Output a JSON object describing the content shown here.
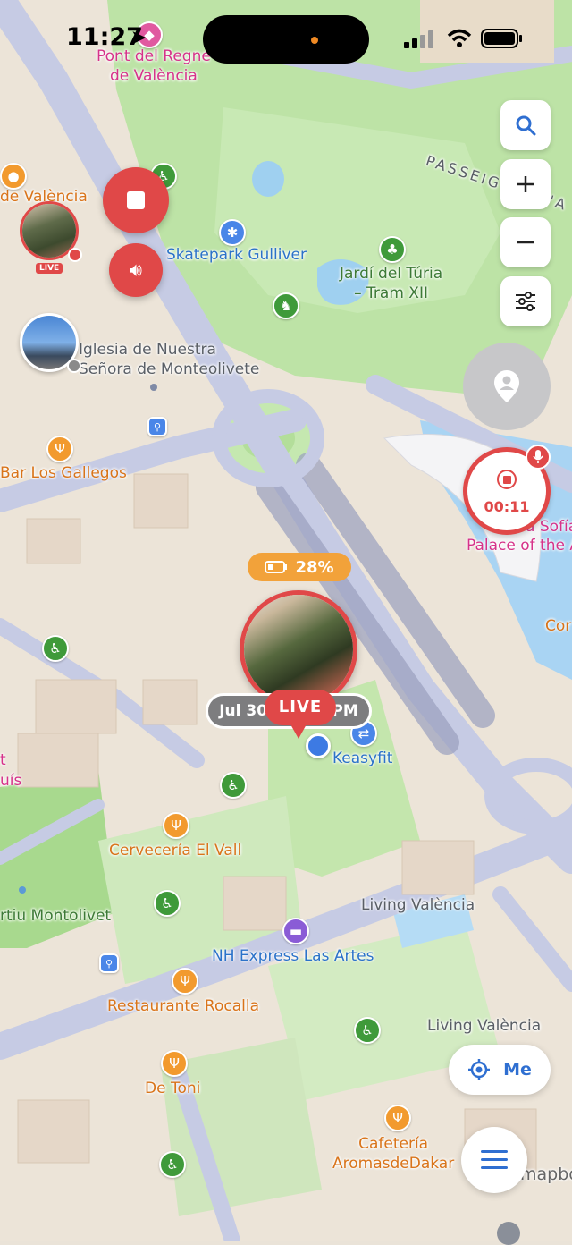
{
  "status_bar": {
    "time": "11:27"
  },
  "map_labels": {
    "pont": "Pont del Regne\nde València",
    "valencia_left": "de València",
    "skatepark": "Skatepark Gulliver",
    "jardi": "Jardí del Túria\n– Tram XII",
    "passeig": "PASSEIG DE L'A",
    "iglesia": "Iglesia de Nuestra\nSeñora de Monteolivete",
    "bar": "Bar Los Gallegos",
    "sofia": "a Sofía",
    "palace": "Palace of the A",
    "cor": "Cor",
    "keasyfit": "Keasyfit",
    "cerveceria": "Cervecería El Vall",
    "living1": "Living València",
    "montolivet": "rtiu Montolivet",
    "nh": "NH Express Las Artes",
    "restaurante": "Restaurante Rocalla",
    "living2": "Living València",
    "detoni": "De Toni",
    "cafeteria": "Cafetería\nAromasdeDakar",
    "left_t": "t",
    "left_luis": "uís",
    "mapbox": "mapbox"
  },
  "user_marker": {
    "battery": "28%",
    "timestamp": "Jul 30, 11:27 PM",
    "live": "LIVE"
  },
  "friend_marker": {
    "live": "LIVE"
  },
  "recording": {
    "elapsed": "00:11"
  },
  "me_button": {
    "label": "Me"
  },
  "icons": {
    "search": "search-icon",
    "zoom_in": "plus-icon",
    "zoom_out": "minus-icon",
    "filters": "sliders-icon",
    "person_pin": "person-pin-icon",
    "stop": "stop-icon",
    "speaker": "speaker-icon",
    "mic": "microphone-icon",
    "locate": "crosshair-icon",
    "menu": "hamburger-menu-icon"
  },
  "colors": {
    "live_red": "#e04848",
    "park_green": "#bfe5a8",
    "water": "#a7d3f2",
    "road": "#c9cde6",
    "battery_orange": "#f2a23a",
    "accent_blue": "#2f6fd1"
  }
}
